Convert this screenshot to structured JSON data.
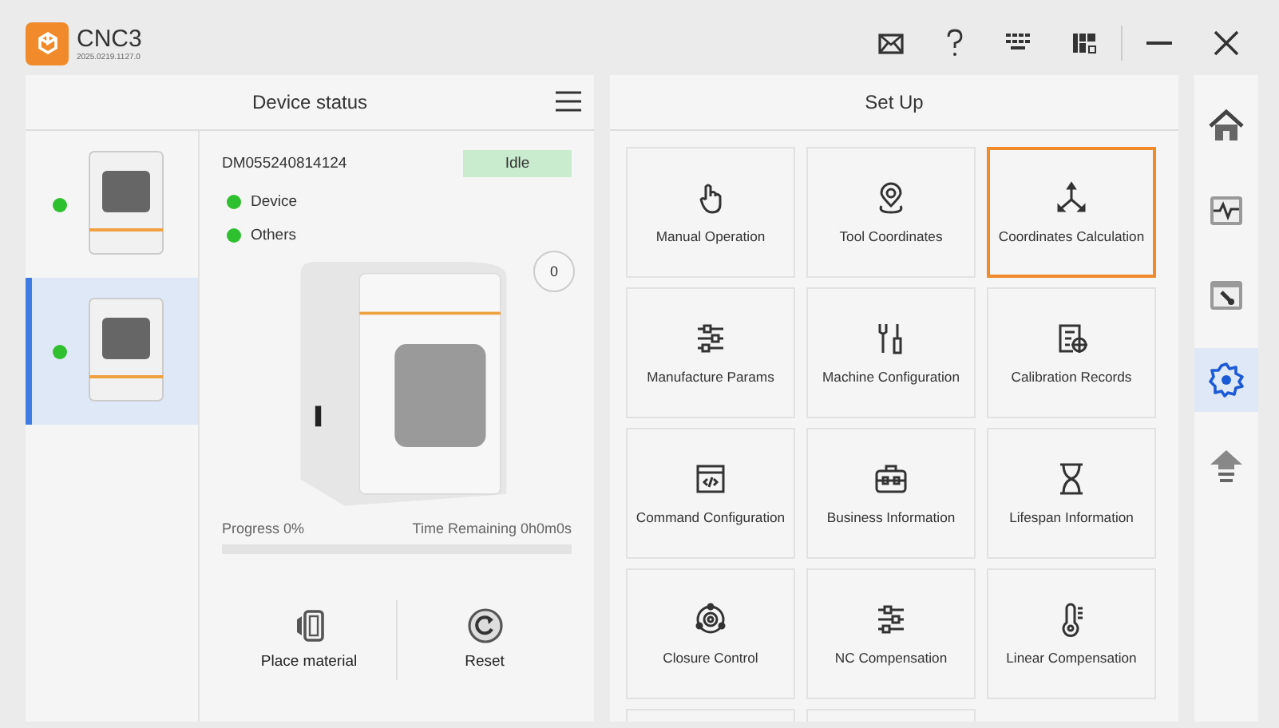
{
  "app": {
    "name": "CNC3",
    "version": "2025.0219.1127.0"
  },
  "device_panel": {
    "title": "Device status",
    "devices": [
      {
        "selected": false,
        "color": "#2fc02f"
      },
      {
        "selected": true,
        "color": "#2fc02f"
      }
    ],
    "detail": {
      "id": "DM055240814124",
      "status": "Idle",
      "indicators": [
        {
          "label": "Device",
          "color": "#2fc02f"
        },
        {
          "label": "Others",
          "color": "#2fc02f"
        }
      ],
      "counter": "0",
      "progress_label": "Progress 0%",
      "time_remaining": "Time Remaining 0h0m0s",
      "progress": {
        "level": 0
      },
      "actions": [
        {
          "label": "Place material",
          "kind": "place"
        },
        {
          "label": "Reset",
          "kind": "reset"
        }
      ]
    }
  },
  "setup_panel": {
    "title": "Set Up",
    "tiles": [
      {
        "label": "Manual Operation",
        "kind": "hand",
        "selected": false
      },
      {
        "label": "Tool Coordinates",
        "kind": "pin",
        "selected": false
      },
      {
        "label": "Coordinates Calculation",
        "kind": "axes",
        "selected": true
      },
      {
        "label": "Manufacture Params",
        "kind": "sliders",
        "selected": false
      },
      {
        "label": "Machine Configuration",
        "kind": "tools",
        "selected": false
      },
      {
        "label": "Calibration Records",
        "kind": "doc",
        "selected": false
      },
      {
        "label": "Command Configuration",
        "kind": "code",
        "selected": false
      },
      {
        "label": "Business Information",
        "kind": "case",
        "selected": false
      },
      {
        "label": "Lifespan Information",
        "kind": "hourglass",
        "selected": false
      },
      {
        "label": "Closure Control",
        "kind": "target",
        "selected": false
      },
      {
        "label": "NC Compensation",
        "kind": "sliders",
        "selected": false
      },
      {
        "label": "Linear Compensation",
        "kind": "thermo",
        "selected": false
      }
    ]
  },
  "nav": [
    {
      "kind": "home",
      "selected": false
    },
    {
      "kind": "monitor",
      "selected": false
    },
    {
      "kind": "maintenance",
      "selected": false
    },
    {
      "kind": "settings",
      "selected": true
    },
    {
      "kind": "upgrade",
      "selected": false
    }
  ]
}
